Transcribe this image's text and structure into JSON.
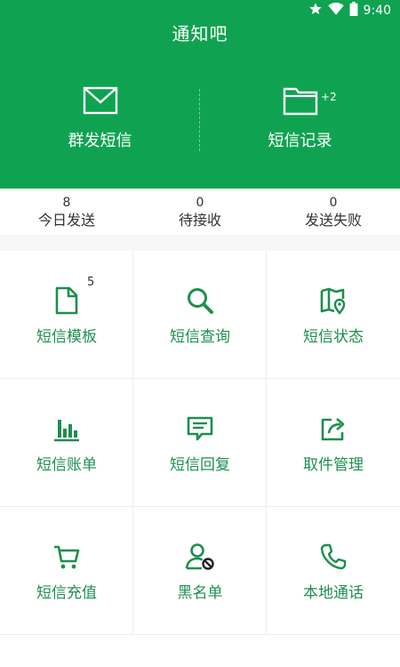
{
  "status_bar": {
    "time": "9:40",
    "icons": [
      "star-icon",
      "wifi-icon",
      "battery-icon"
    ]
  },
  "header": {
    "title": "通知吧",
    "actions": [
      {
        "label": "群发短信",
        "icon": "envelope-icon"
      },
      {
        "label": "短信记录",
        "icon": "folder-icon",
        "badge": "+2"
      }
    ]
  },
  "stats": [
    {
      "value": "8",
      "label": "今日发送"
    },
    {
      "value": "0",
      "label": "待接收"
    },
    {
      "value": "0",
      "label": "发送失败"
    }
  ],
  "menu": [
    {
      "label": "短信模板",
      "icon": "document-icon",
      "badge": "5"
    },
    {
      "label": "短信查询",
      "icon": "search-icon"
    },
    {
      "label": "短信状态",
      "icon": "map-book-icon"
    },
    {
      "label": "短信账单",
      "icon": "bar-chart-icon"
    },
    {
      "label": "短信回复",
      "icon": "chat-message-icon"
    },
    {
      "label": "取件管理",
      "icon": "share-export-icon"
    },
    {
      "label": "短信充值",
      "icon": "shopping-cart-icon"
    },
    {
      "label": "黑名单",
      "icon": "blocked-user-icon"
    },
    {
      "label": "本地通话",
      "icon": "phone-icon"
    }
  ],
  "colors": {
    "primary": "#0fa351",
    "accent_text": "#1d8f4d"
  }
}
